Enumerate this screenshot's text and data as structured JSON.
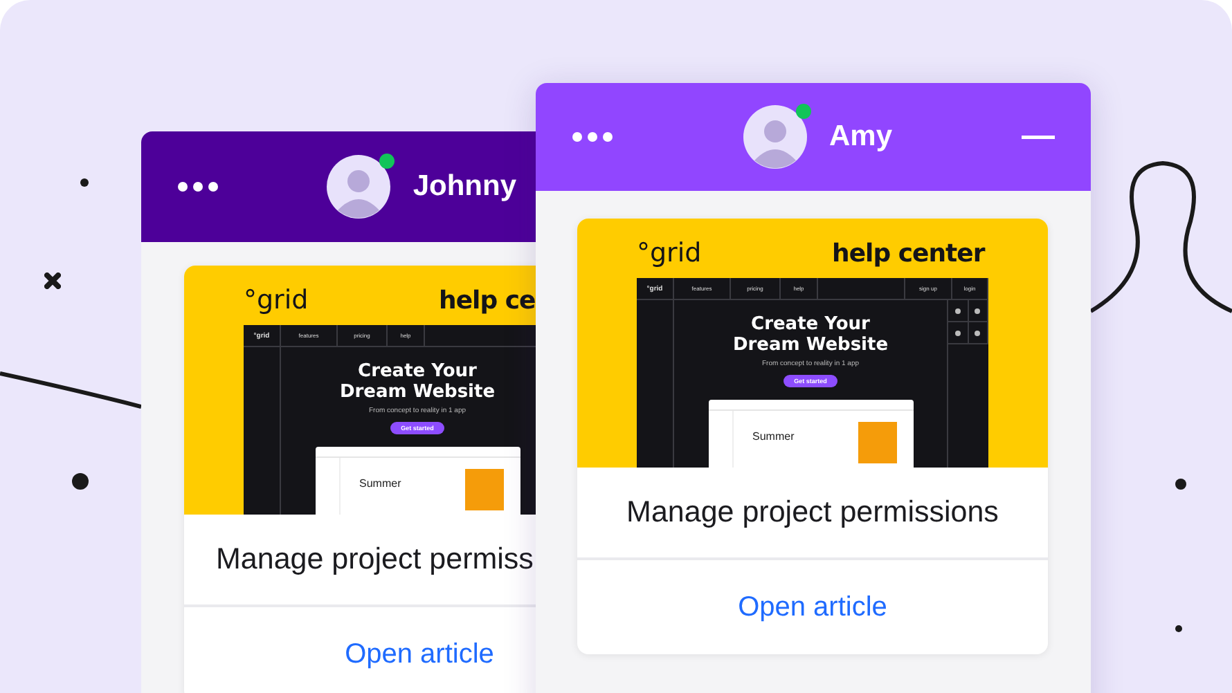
{
  "windows": [
    {
      "kind": "back",
      "name": "Johnny",
      "online": true,
      "card": {
        "brand": "°grid",
        "section": "help ce",
        "mockup_logo": "°grid",
        "nav": [
          "features",
          "pricing",
          "help"
        ],
        "hero_title": "Create Your Dream Website",
        "hero_subtitle": "From concept to reality in 1 app",
        "cta": "Get started",
        "preview_text": "Summer",
        "title": "Manage project permiss",
        "link": "Open article"
      }
    },
    {
      "kind": "front",
      "name": "Amy",
      "online": true,
      "card": {
        "brand": "°grid",
        "section": "help center",
        "mockup_logo": "°grid",
        "nav": [
          "features",
          "pricing",
          "help"
        ],
        "nav_right": [
          "sign up",
          "login"
        ],
        "hero_title": "Create Your Dream Website",
        "hero_subtitle": "From concept to reality in 1 app",
        "cta": "Get started",
        "preview_text": "Summer",
        "title": "Manage project permissions",
        "link": "Open article"
      }
    }
  ]
}
